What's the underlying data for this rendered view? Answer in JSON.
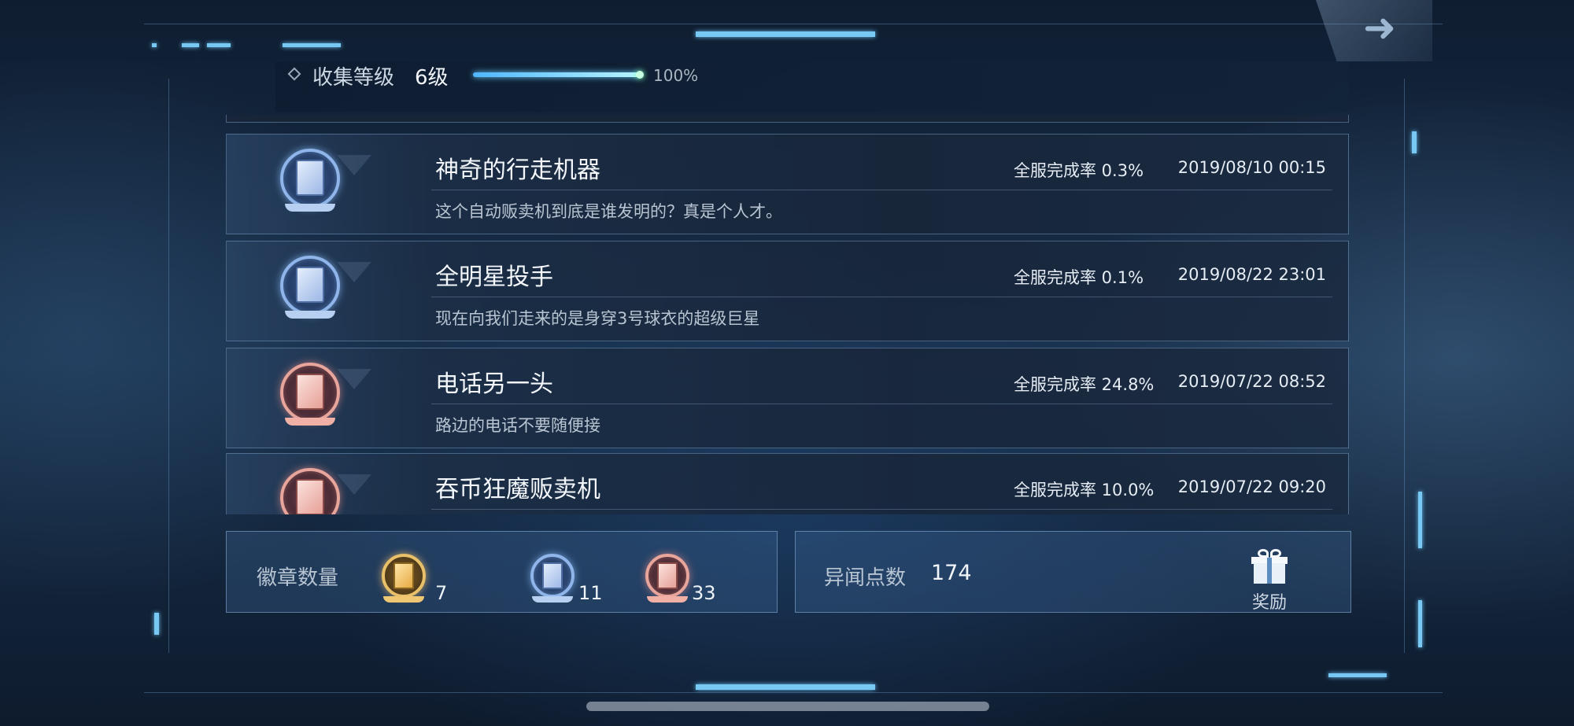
{
  "header": {
    "level_label": "收集等级",
    "level_value": "6级",
    "progress": 1.0,
    "progress_text": "100%"
  },
  "achievements": [
    {
      "title": "神奇的行走机器",
      "rate": "全服完成率 0.3%",
      "date": "2019/08/10 00:15",
      "desc": "这个自动贩卖机到底是谁发明的？真是个人才。",
      "badge": "blue-badge-icon"
    },
    {
      "title": "全明星投手",
      "rate": "全服完成率 0.1%",
      "date": "2019/08/22 23:01",
      "desc": "现在向我们走来的是身穿3号球衣的超级巨星",
      "badge": "blue-badge-icon"
    },
    {
      "title": "电话另一头",
      "rate": "全服完成率 24.8%",
      "date": "2019/07/22 08:52",
      "desc": "路边的电话不要随便接",
      "badge": "red-badge-icon"
    },
    {
      "title": "吞币狂魔贩卖机",
      "rate": "全服完成率 10.0%",
      "date": "2019/07/22 09:20",
      "desc": "",
      "badge": "red-badge-icon"
    }
  ],
  "badge_summary": {
    "label": "徽章数量",
    "gold_count": "7",
    "blue_count": "11",
    "red_count": "33"
  },
  "points": {
    "label": "异闻点数",
    "value": "174",
    "reward_label": "奖励"
  },
  "colors": {
    "accent": "#78c8f4",
    "background": "#18304c"
  }
}
